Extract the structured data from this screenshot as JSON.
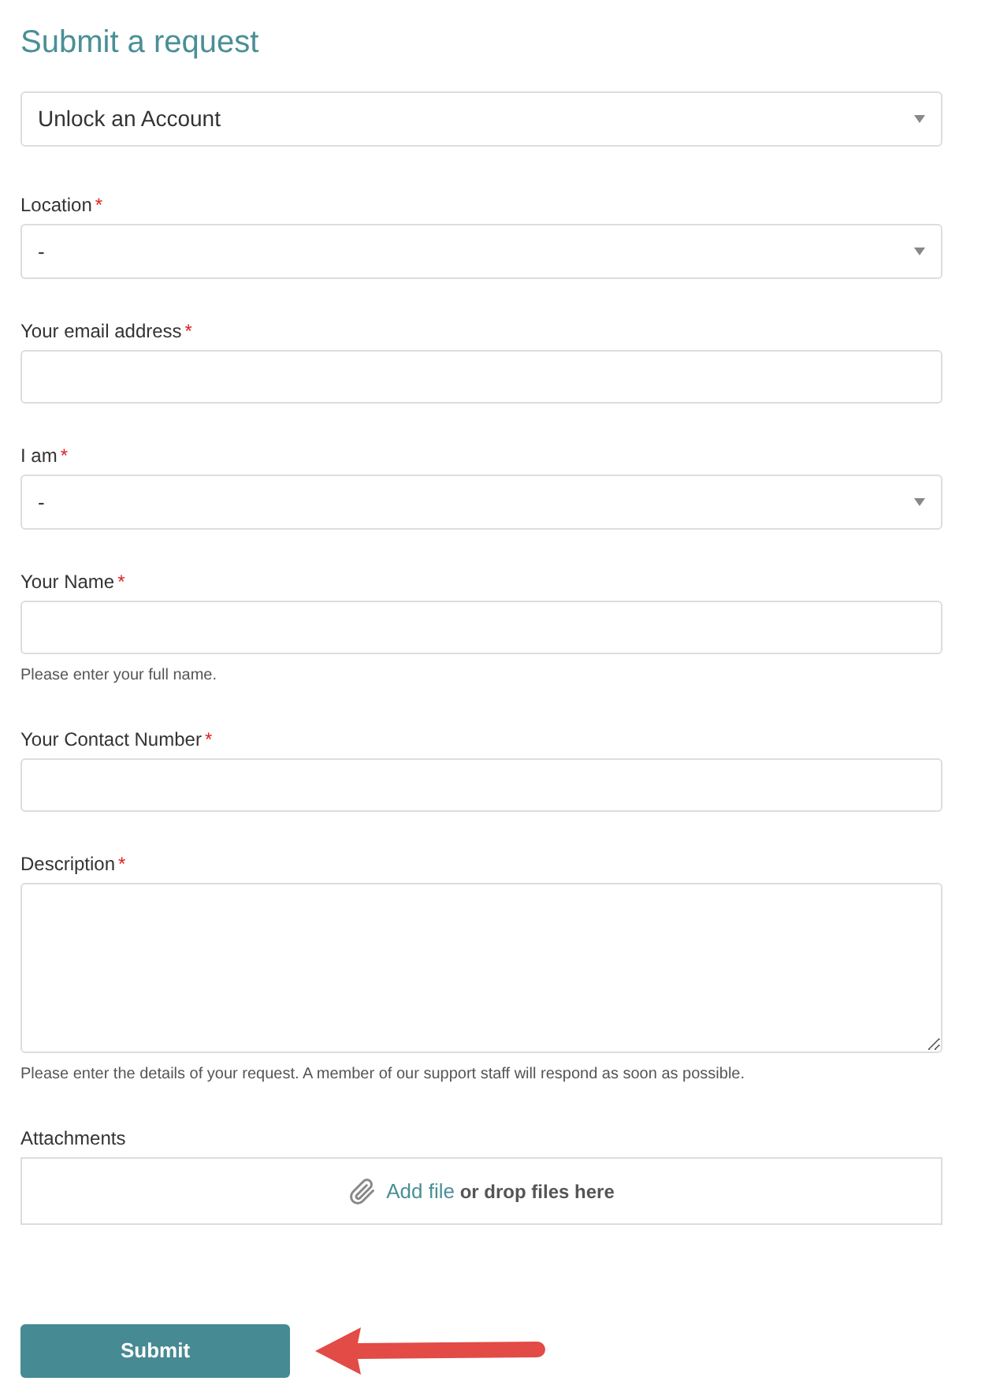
{
  "title": "Submit a request",
  "request_type": {
    "value": "Unlock an Account"
  },
  "required_mark": "*",
  "fields": [
    {
      "kind": "select",
      "label": "Location",
      "required": true,
      "value": "-"
    },
    {
      "kind": "text",
      "label": "Your email address",
      "required": true
    },
    {
      "kind": "select",
      "label": "I am",
      "required": true,
      "value": "-"
    },
    {
      "kind": "text",
      "label": "Your Name",
      "required": true,
      "hint": "Please enter your full name."
    },
    {
      "kind": "text",
      "label": "Your Contact Number",
      "required": true
    },
    {
      "kind": "textarea",
      "label": "Description",
      "required": true,
      "hint": "Please enter the details of your request. A member of our support staff will respond as soon as possible."
    },
    {
      "kind": "attachments",
      "label": "Attachments",
      "required": false,
      "link": "Add file",
      "rest": "or drop files here"
    }
  ],
  "submit": "Submit"
}
